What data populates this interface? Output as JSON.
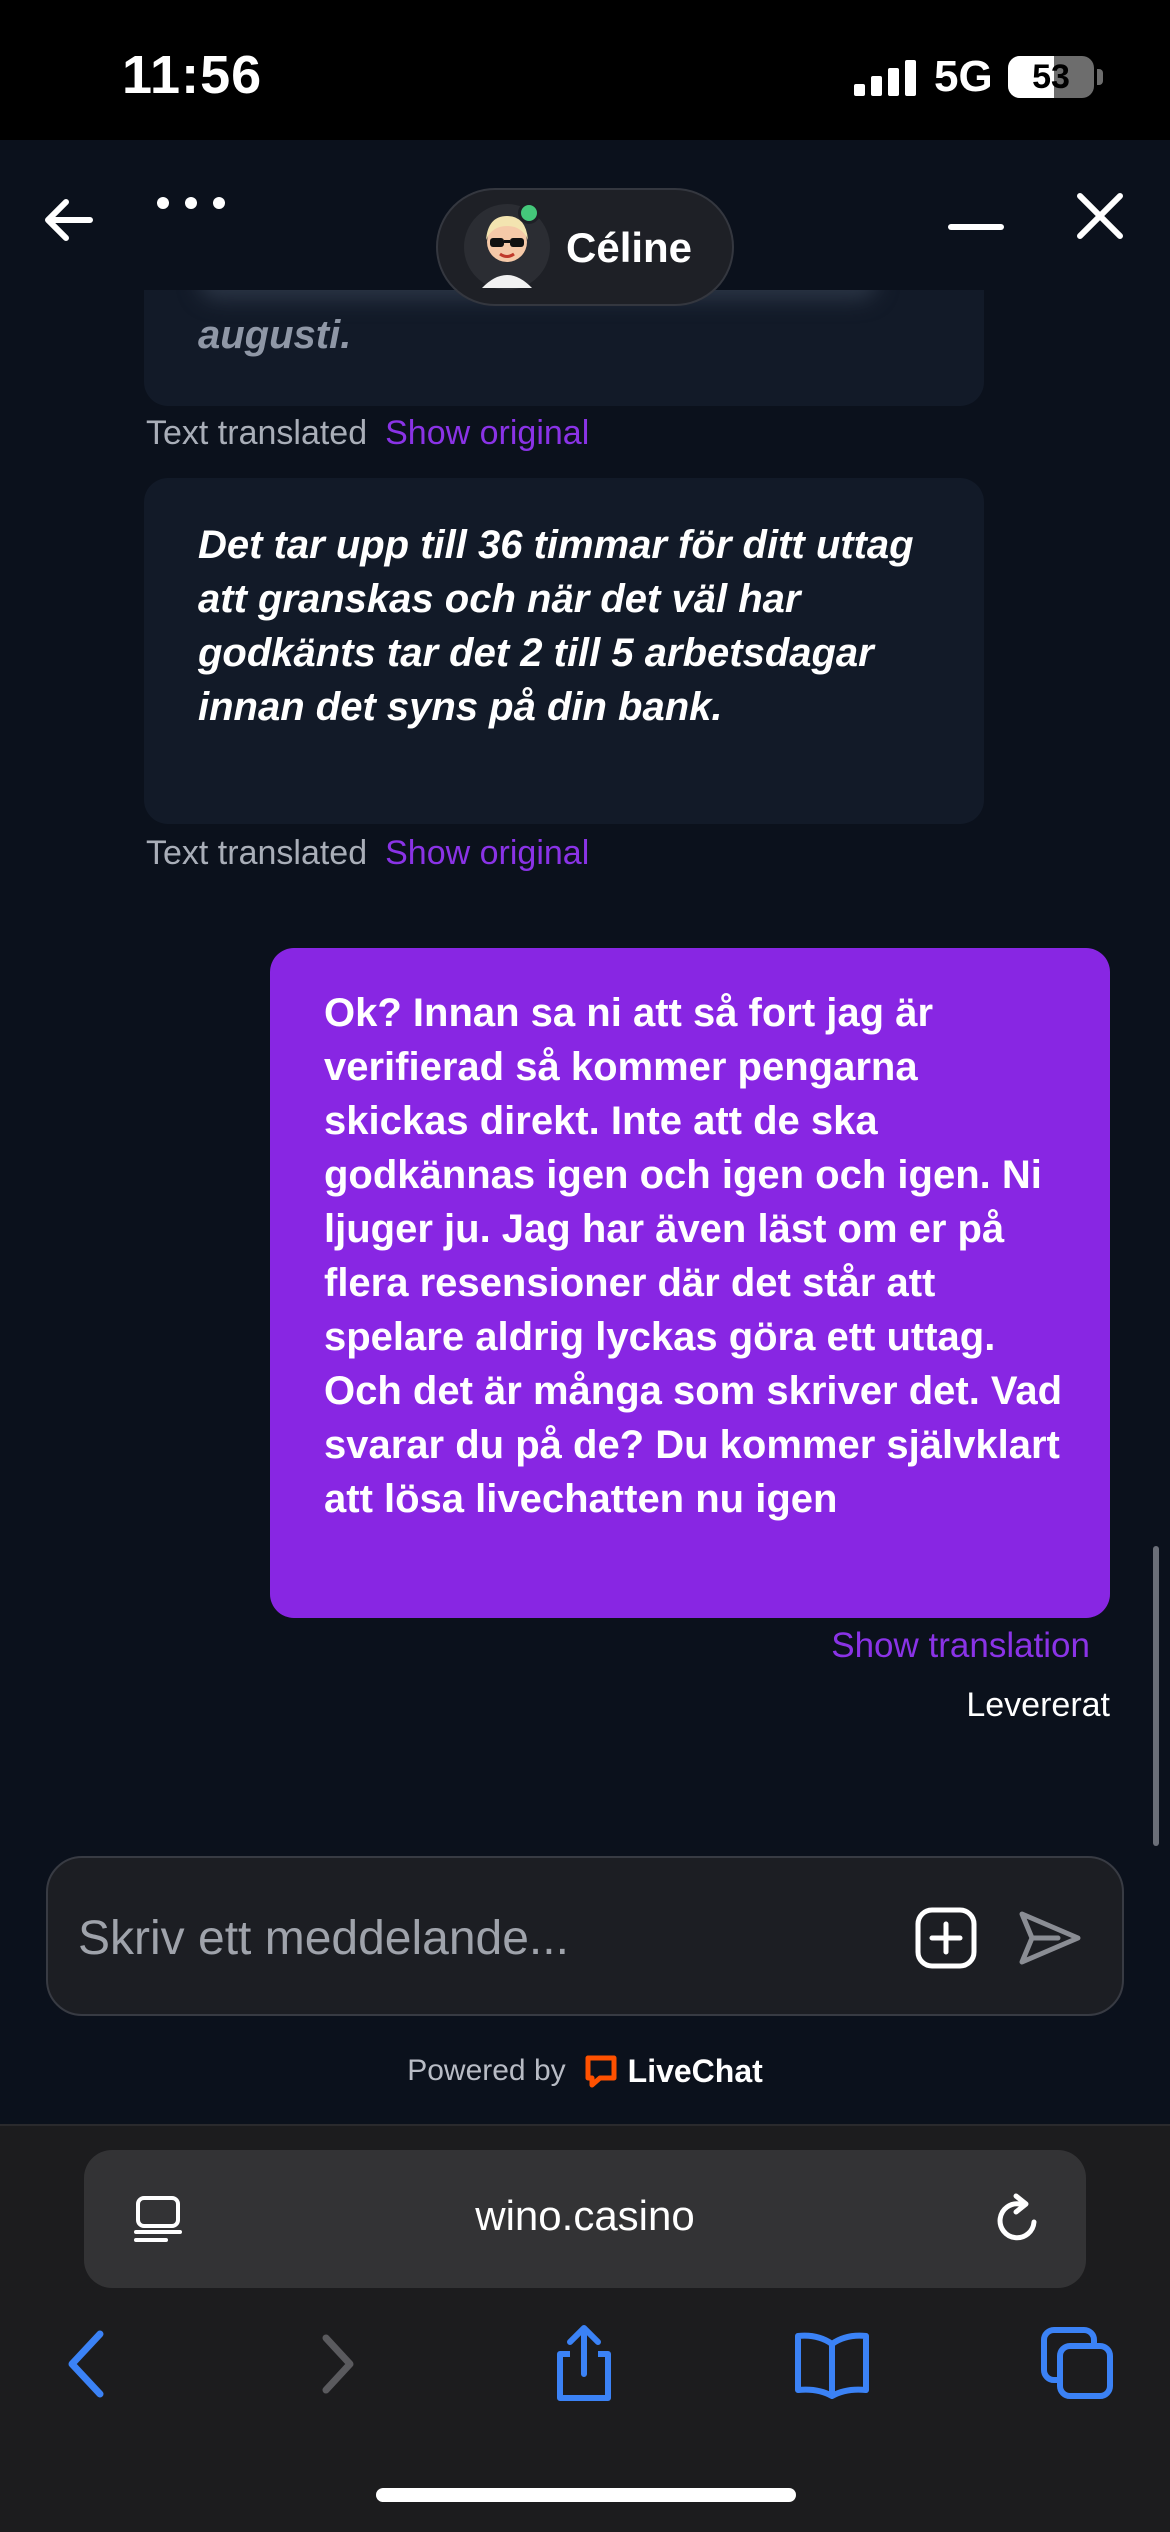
{
  "status_bar": {
    "time": "11:56",
    "network": "5G",
    "battery": "53",
    "battery_level": 0.53
  },
  "header": {
    "agent_name": "Céline",
    "agent_online": true
  },
  "messages": {
    "agent_1_visible_text": "augusti.",
    "agent_1_meta": "Text translated",
    "agent_1_link": "Show original",
    "agent_2_text": "Det tar upp till 36 timmar för ditt uttag att granskas och när det väl har godkänts tar det 2 till 5 arbetsdagar innan det syns på din bank.",
    "agent_2_meta": "Text translated",
    "agent_2_link": "Show original",
    "user_text": "Ok? Innan sa ni att så fort jag är verifierad så kommer pengarna skickas direkt. Inte att de ska godkännas igen och igen och igen. Ni ljuger ju. Jag har även läst om er på flera resensioner där det står att spelare aldrig lyckas göra ett uttag. Och det är många som skriver det. Vad svarar du på de? Du kommer självklart att lösa livechatten nu igen",
    "user_link": "Show translation",
    "user_status": "Levererat"
  },
  "composer": {
    "placeholder": "Skriv ett meddelande..."
  },
  "footer": {
    "powered_by": "Powered by",
    "brand": "LiveChat"
  },
  "browser": {
    "url": "wino.casino"
  },
  "colors": {
    "accent": "#8826e3",
    "link": "#8a33e6",
    "background": "#0b111c",
    "safari_blue": "#3b82f6"
  },
  "icons": [
    "back-arrow-icon",
    "more-icon",
    "minimize-icon",
    "close-icon",
    "attach-icon",
    "send-icon",
    "livechat-icon",
    "reader-icon",
    "reload-icon",
    "nav-back-icon",
    "nav-forward-icon",
    "share-icon",
    "bookmarks-icon",
    "tabs-icon"
  ]
}
